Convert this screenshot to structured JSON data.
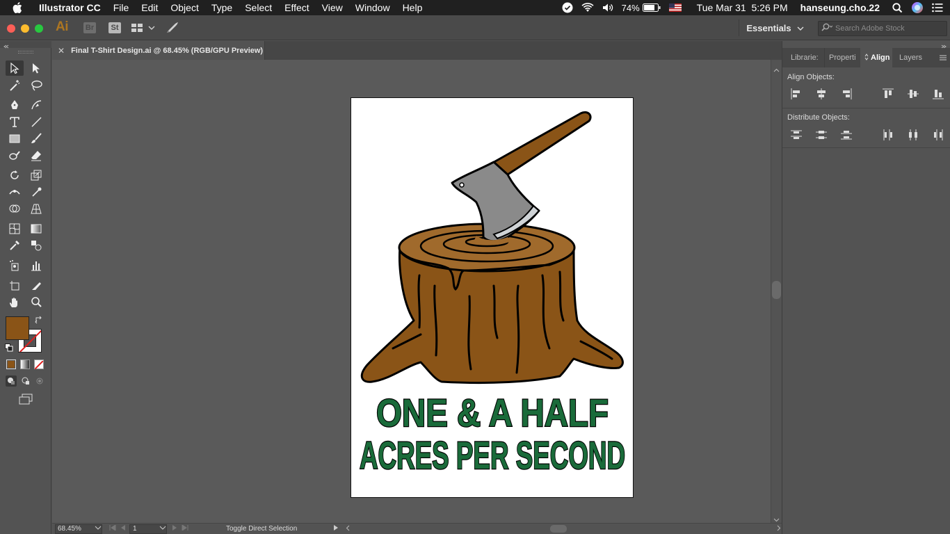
{
  "menubar": {
    "app_name": "Illustrator CC",
    "menus": [
      "File",
      "Edit",
      "Object",
      "Type",
      "Select",
      "Effect",
      "View",
      "Window",
      "Help"
    ],
    "battery": "74%",
    "datetime": "Tue Mar 31  5:26 PM",
    "user": "hanseung.cho.22"
  },
  "appbar": {
    "logo": "Ai",
    "bridge": "Br",
    "stock": "St",
    "workspace": "Essentials",
    "search_placeholder": "Search Adobe Stock"
  },
  "document": {
    "tab_title": "Final T-Shirt Design.ai @ 68.45% (RGB/GPU Preview)",
    "artwork_line1": "ONE & A HALF",
    "artwork_line2": "ACRES PER SECOND"
  },
  "statusbar": {
    "zoom": "68.45%",
    "page": "1",
    "status_text": "Toggle Direct Selection"
  },
  "right_panel": {
    "tabs": [
      "Librarie:",
      "Properti",
      "Align",
      "Layers"
    ],
    "active_tab": "Align",
    "align_objects_label": "Align Objects:",
    "distribute_objects_label": "Distribute Objects:"
  },
  "colors": {
    "fill": "#8a5417",
    "stroke": "#ffffff",
    "text_fill": "#1a6b3a",
    "stump": "#8a5417",
    "stump_top": "#a06a2c"
  },
  "tools": [
    "selection-icon",
    "direct-selection-icon",
    "magic-wand-icon",
    "lasso-icon",
    "pen-icon",
    "curvature-icon",
    "type-icon",
    "line-icon",
    "rectangle-icon",
    "paintbrush-icon",
    "shaper-icon",
    "eraser-icon",
    "rotate-icon",
    "scale-icon",
    "width-icon",
    "puppet-warp-icon",
    "shape-builder-icon",
    "perspective-grid-icon",
    "mesh-icon",
    "gradient-icon",
    "eyedropper-icon",
    "blend-icon",
    "symbol-sprayer-icon",
    "column-graph-icon",
    "artboard-icon",
    "slice-icon",
    "hand-icon",
    "zoom-icon"
  ]
}
